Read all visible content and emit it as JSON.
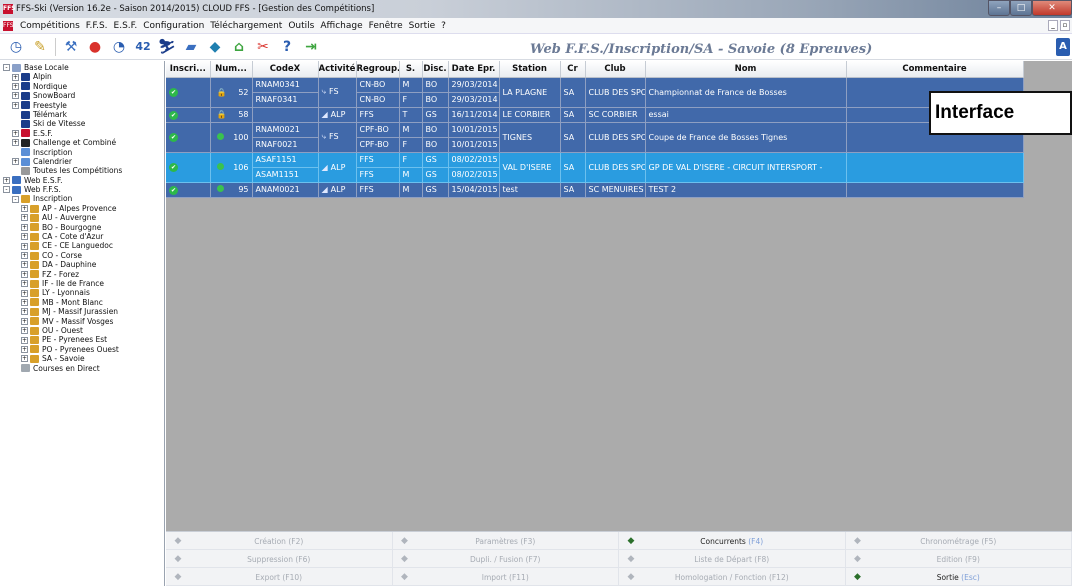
{
  "window": {
    "title": "FFS-Ski (Version 16.2e - Saison 2014/2015) CLOUD FFS - [Gestion des Compétitions]",
    "app_icon_text": "FFS"
  },
  "menu": [
    "Compétitions",
    "F.F.S.",
    "E.S.F.",
    "Configuration",
    "Téléchargement",
    "Outils",
    "Affichage",
    "Fenêtre",
    "Sortie",
    "?"
  ],
  "context_title": "Web F.F.S./Inscription/SA - Savoie (8 Epreuves)",
  "toolbar_icons": [
    "timer-icon",
    "edit-icon",
    "tools-icon",
    "ball-icon",
    "clock-icon",
    "numbers-icon",
    "ski-icon",
    "snowboard-icon",
    "freestyle-icon",
    "home-icon",
    "scissors-icon",
    "help-icon",
    "exit-icon"
  ],
  "tree": [
    {
      "label": "Base Locale",
      "level": 0,
      "exp": "-",
      "color": "#8aa0c8"
    },
    {
      "label": "Alpin",
      "level": 1,
      "exp": "+",
      "color": "#1a3c8a"
    },
    {
      "label": "Nordique",
      "level": 1,
      "exp": "+",
      "color": "#1a3c8a"
    },
    {
      "label": "SnowBoard",
      "level": 1,
      "exp": "+",
      "color": "#1a3c8a"
    },
    {
      "label": "Freestyle",
      "level": 1,
      "exp": "+",
      "color": "#1a3c8a"
    },
    {
      "label": "Télémark",
      "level": 1,
      "exp": "",
      "color": "#1a3c8a"
    },
    {
      "label": "Ski de Vitesse",
      "level": 1,
      "exp": "",
      "color": "#1a3c8a"
    },
    {
      "label": "E.S.F.",
      "level": 1,
      "exp": "+",
      "color": "#c8102e"
    },
    {
      "label": "Challenge et Combiné",
      "level": 1,
      "exp": "+",
      "color": "#222"
    },
    {
      "label": "Inscription",
      "level": 1,
      "exp": "",
      "color": "#5b8fd6"
    },
    {
      "label": "Calendrier",
      "level": 1,
      "exp": "+",
      "color": "#5b8fd6"
    },
    {
      "label": "Toutes les Compétitions",
      "level": 1,
      "exp": "",
      "color": "#999"
    },
    {
      "label": "Web E.S.F.",
      "level": 0,
      "exp": "+",
      "color": "#3a6fc0"
    },
    {
      "label": "Web F.F.S.",
      "level": 0,
      "exp": "-",
      "color": "#3a6fc0"
    },
    {
      "label": "Inscription",
      "level": 1,
      "exp": "-",
      "color": "#d8a02a"
    },
    {
      "label": "AP - Alpes Provence",
      "level": 2,
      "exp": "+",
      "color": "#d8a02a"
    },
    {
      "label": "AU - Auvergne",
      "level": 2,
      "exp": "+",
      "color": "#d8a02a"
    },
    {
      "label": "BO - Bourgogne",
      "level": 2,
      "exp": "+",
      "color": "#d8a02a"
    },
    {
      "label": "CA - Cote d'Azur",
      "level": 2,
      "exp": "+",
      "color": "#d8a02a"
    },
    {
      "label": "CE - CE Languedoc",
      "level": 2,
      "exp": "+",
      "color": "#d8a02a"
    },
    {
      "label": "CO - Corse",
      "level": 2,
      "exp": "+",
      "color": "#d8a02a"
    },
    {
      "label": "DA - Dauphine",
      "level": 2,
      "exp": "+",
      "color": "#d8a02a"
    },
    {
      "label": "FZ - Forez",
      "level": 2,
      "exp": "+",
      "color": "#d8a02a"
    },
    {
      "label": "IF - Ile de France",
      "level": 2,
      "exp": "+",
      "color": "#d8a02a"
    },
    {
      "label": "LY - Lyonnais",
      "level": 2,
      "exp": "+",
      "color": "#d8a02a"
    },
    {
      "label": "MB - Mont Blanc",
      "level": 2,
      "exp": "+",
      "color": "#d8a02a"
    },
    {
      "label": "MJ - Massif Jurassien",
      "level": 2,
      "exp": "+",
      "color": "#d8a02a"
    },
    {
      "label": "MV - Massif Vosges",
      "level": 2,
      "exp": "+",
      "color": "#d8a02a"
    },
    {
      "label": "OU - Ouest",
      "level": 2,
      "exp": "+",
      "color": "#d8a02a"
    },
    {
      "label": "PE - Pyrenees Est",
      "level": 2,
      "exp": "+",
      "color": "#d8a02a"
    },
    {
      "label": "PO - Pyrenees Ouest",
      "level": 2,
      "exp": "+",
      "color": "#d8a02a"
    },
    {
      "label": "SA - Savoie",
      "level": 2,
      "exp": "+",
      "color": "#d8a02a"
    },
    {
      "label": "Courses en Direct",
      "level": 1,
      "exp": "",
      "color": "#a0a8b0"
    }
  ],
  "grid": {
    "columns": [
      "Inscri...",
      "Num...",
      "CodeX",
      "Activité",
      "Regroup.",
      "S.",
      "Disc.",
      "Date Epr.",
      "Station",
      "Cr",
      "Club",
      "Nom",
      "Commentaire"
    ],
    "rows": [
      {
        "status": "lock",
        "num": "52",
        "codes": [
          "RNAM0341",
          "RNAF0341"
        ],
        "activite": "FS",
        "regroup": [
          "CN-BO",
          "CN-BO"
        ],
        "sexe": [
          "M",
          "F"
        ],
        "disc": [
          "BO",
          "BO"
        ],
        "dates": [
          "29/03/2014",
          "29/03/2014"
        ],
        "station": "LA PLAGNE",
        "cr": "SA",
        "club": "CLUB DES SPO...",
        "nom": "Championnat de France de Bosses",
        "commentaire": "",
        "selected": false
      },
      {
        "status": "lock",
        "num": "58",
        "codes": [
          ""
        ],
        "activite": "ALP",
        "regroup": [
          "FFS"
        ],
        "sexe": [
          "T"
        ],
        "disc": [
          "GS"
        ],
        "dates": [
          "16/11/2014"
        ],
        "station": "LE CORBIER",
        "cr": "SA",
        "club": "SC CORBIER",
        "nom": "essai",
        "commentaire": "",
        "selected": false
      },
      {
        "status": "dot",
        "num": "100",
        "codes": [
          "RNAM0021",
          "RNAF0021"
        ],
        "activite": "FS",
        "regroup": [
          "CPF-BO",
          "CPF-BO"
        ],
        "sexe": [
          "M",
          "F"
        ],
        "disc": [
          "BO",
          "BO"
        ],
        "dates": [
          "10/01/2015",
          "10/01/2015"
        ],
        "station": "TIGNES",
        "cr": "SA",
        "club": "CLUB DES SPO...",
        "nom": "Coupe de France de Bosses Tignes",
        "commentaire": "",
        "selected": false
      },
      {
        "status": "dot",
        "num": "106",
        "codes": [
          "ASAF1151",
          "ASAM1151"
        ],
        "activite": "ALP",
        "regroup": [
          "FFS",
          "FFS"
        ],
        "sexe": [
          "F",
          "M"
        ],
        "disc": [
          "GS",
          "GS"
        ],
        "dates": [
          "08/02/2015",
          "08/02/2015"
        ],
        "station": "VAL D'ISERE",
        "cr": "SA",
        "club": "CLUB DES SPO...",
        "nom": "GP DE VAL D'ISERE - CIRCUIT INTERSPORT -",
        "commentaire": "",
        "selected": true
      },
      {
        "status": "dot",
        "num": "95",
        "codes": [
          "ANAM0021"
        ],
        "activite": "ALP",
        "regroup": [
          "FFS"
        ],
        "sexe": [
          "M"
        ],
        "disc": [
          "GS"
        ],
        "dates": [
          "15/04/2015"
        ],
        "station": "test",
        "cr": "SA",
        "club": "SC MENUIRES",
        "nom": "TEST 2",
        "commentaire": "",
        "selected": false
      }
    ]
  },
  "overlay_label": "Interface",
  "actions": [
    [
      {
        "label": "Création",
        "key": "(F2)",
        "icon": "plus-icon",
        "active": false
      },
      {
        "label": "Paramètres",
        "key": "(F3)",
        "icon": "gear-icon",
        "active": false
      },
      {
        "label": "Concurrents",
        "key": "(F4)",
        "icon": "person-icon",
        "active": true
      },
      {
        "label": "Chronométrage",
        "key": "(F5)",
        "icon": "stopwatch-icon",
        "active": false
      }
    ],
    [
      {
        "label": "Suppression",
        "key": "(F6)",
        "icon": "cross-icon",
        "active": false
      },
      {
        "label": "Dupli. / Fusion",
        "key": "(F7)",
        "icon": "merge-icon",
        "active": false
      },
      {
        "label": "Liste de Départ",
        "key": "(F8)",
        "icon": "list-icon",
        "active": false
      },
      {
        "label": "Edition",
        "key": "(F9)",
        "icon": "print-icon",
        "active": false
      }
    ],
    [
      {
        "label": "Export",
        "key": "(F10)",
        "icon": "export-icon",
        "active": false
      },
      {
        "label": "Import",
        "key": "(F11)",
        "icon": "import-icon",
        "active": false
      },
      {
        "label": "Homologation / Fonction",
        "key": "(F12)",
        "icon": "stamp-icon",
        "active": false
      },
      {
        "label": "Sortie",
        "key": "(Esc)",
        "icon": "door-icon",
        "active": true
      }
    ]
  ]
}
